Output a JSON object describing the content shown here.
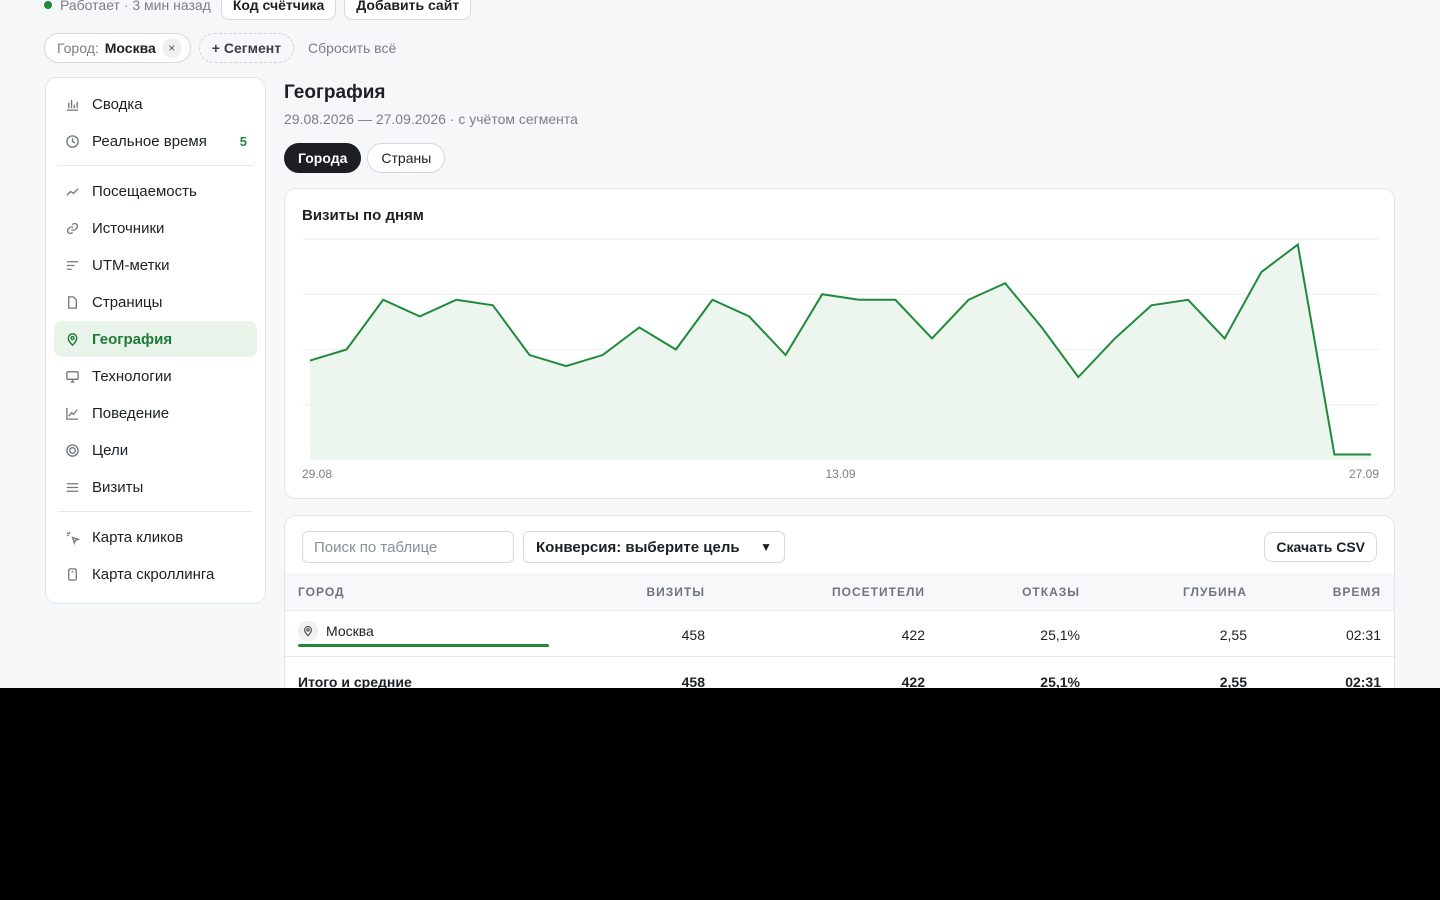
{
  "topbar": {
    "status_text": "Работает · 3 мин назад",
    "counter_code_button": "Код счётчика",
    "add_site_button": "Добавить сайт"
  },
  "filters": {
    "chip_key": "Город:",
    "chip_value": "Москва",
    "chip_remove": "×",
    "add_segment": "+ Сегмент",
    "reset_all": "Сбросить всё"
  },
  "sidebar": {
    "items": [
      {
        "label": "Сводка",
        "icon": "bar-chart-icon"
      },
      {
        "label": "Реальное время",
        "icon": "clock-icon",
        "count": "5"
      },
      {
        "label": "Посещаемость",
        "icon": "trend-icon"
      },
      {
        "label": "Источники",
        "icon": "link-icon"
      },
      {
        "label": "UTM-метки",
        "icon": "lines-icon"
      },
      {
        "label": "Страницы",
        "icon": "file-icon"
      },
      {
        "label": "География",
        "icon": "map-pin-icon",
        "active": true
      },
      {
        "label": "Технологии",
        "icon": "monitor-icon"
      },
      {
        "label": "Поведение",
        "icon": "line-chart-icon"
      },
      {
        "label": "Цели",
        "icon": "target-icon"
      },
      {
        "label": "Визиты",
        "icon": "list-icon"
      },
      {
        "label": "Карта кликов",
        "icon": "cursor-icon"
      },
      {
        "label": "Карта скроллинга",
        "icon": "phone-icon"
      }
    ]
  },
  "main": {
    "title": "География",
    "subtitle": "29.08.2026 — 27.09.2026 · с учётом сегмента",
    "tabs": [
      {
        "label": "Города",
        "active": true
      },
      {
        "label": "Страны",
        "active": false
      }
    ]
  },
  "chart_data": {
    "type": "area",
    "title": "Визиты по дням",
    "x_tick_labels": [
      "29.08",
      "13.09",
      "27.09"
    ],
    "x": [
      "29.08",
      "30.08",
      "31.08",
      "01.09",
      "02.09",
      "03.09",
      "04.09",
      "05.09",
      "06.09",
      "07.09",
      "08.09",
      "09.09",
      "10.09",
      "11.09",
      "12.09",
      "13.09",
      "14.09",
      "15.09",
      "16.09",
      "17.09",
      "18.09",
      "19.09",
      "20.09",
      "21.09",
      "22.09",
      "23.09",
      "24.09",
      "25.09",
      "26.09",
      "27.09"
    ],
    "series": [
      {
        "values": [
          18,
          20,
          29,
          26,
          29,
          28,
          19,
          17,
          19,
          24,
          20,
          29,
          26,
          19,
          30,
          29,
          29,
          22,
          29,
          32,
          24,
          15,
          22,
          28,
          29,
          22,
          34,
          39,
          1,
          1
        ]
      }
    ],
    "ylim": [
      0,
      40
    ],
    "grid": true,
    "color": "#1f8a3b",
    "fill": "#ecf6ee"
  },
  "table": {
    "search_placeholder": "Поиск по таблице",
    "conversion_select": "Конверсия: выберите цель",
    "download_csv": "Скачать CSV",
    "columns": [
      "ГОРОД",
      "ВИЗИТЫ",
      "ПОСЕТИТЕЛИ",
      "ОТКАЗЫ",
      "ГЛУБИНА",
      "ВРЕМЯ"
    ],
    "rows": [
      {
        "city": "Москва",
        "visits": "458",
        "visitors": "422",
        "bounce": "25,1%",
        "depth": "2,55",
        "time": "02:31",
        "share": 1.0
      }
    ],
    "totals": {
      "label": "Итого и средние",
      "visits": "458",
      "visitors": "422",
      "bounce": "25,1%",
      "depth": "2,55",
      "time": "02:31"
    }
  }
}
